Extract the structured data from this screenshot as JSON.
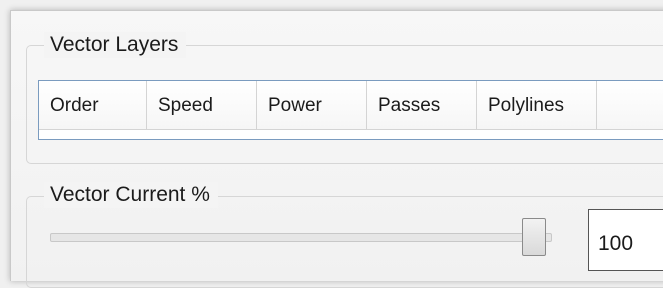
{
  "vector_layers": {
    "title": "Vector Layers",
    "columns": [
      "Order",
      "Speed",
      "Power",
      "Passes",
      "Polylines",
      ""
    ]
  },
  "vector_current": {
    "title": "Vector Current %",
    "value": "100",
    "slider_fraction": 1.0
  }
}
